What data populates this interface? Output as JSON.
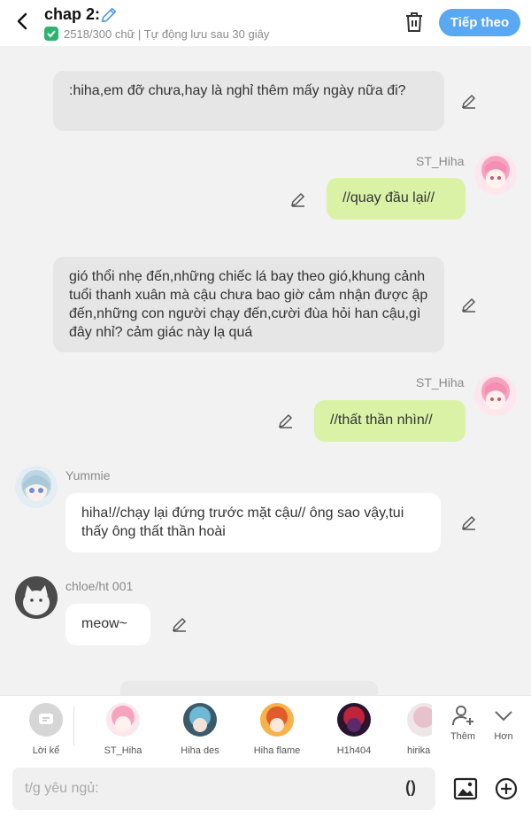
{
  "header": {
    "title": "chap 2:",
    "subtitle": "2518/300 chữ | Tự động lưu sau 30 giây",
    "next_label": "Tiếp theo"
  },
  "messages": [
    {
      "text": ":hiha,em đỡ chưa,hay là nghỉ thêm mấy ngày nữa đi?"
    },
    {
      "sender": "ST_Hiha",
      "text": "//quay đầu lại//"
    },
    {
      "text": "gió thổi nhẹ đến,những chiếc lá bay theo gió,khung cảnh tuổi thanh xuân mà cậu chưa bao giờ cảm nhận được ập đến,những con người chạy đến,cười đùa hỏi han cậu,gì đây nhỉ? cảm giác này lạ quá"
    },
    {
      "sender": "ST_Hiha",
      "text": "//thất thần nhìn//"
    },
    {
      "sender": "Yummie",
      "text": "hiha!//chạy lại đứng trước mặt cậu// ông sao vậy,tui thấy ông thất thần hoài"
    },
    {
      "sender": "chloe/ht 001",
      "text": "meow~"
    }
  ],
  "characters": [
    {
      "label": "Lời kể"
    },
    {
      "label": "ST_Hiha"
    },
    {
      "label": "Hiha des"
    },
    {
      "label": "Hiha flame"
    },
    {
      "label": "H1h404"
    },
    {
      "label": "hirika"
    },
    {
      "label": "Thêm"
    },
    {
      "label": "Hơn"
    }
  ],
  "input": {
    "placeholder": "t/g yêu ngủ:",
    "paren": "()"
  },
  "colors": {
    "accent": "#5aa7f2",
    "green_bubble": "#d9f2a6",
    "grey_bubble": "#e6e6e6",
    "check": "#2db36f"
  },
  "icons": [
    "back-arrow-icon",
    "pencil-icon",
    "check-icon",
    "trash-icon",
    "edit-pen-icon",
    "narrator-icon",
    "add-person-icon",
    "chevron-down-icon",
    "image-icon",
    "add-circle-icon"
  ]
}
